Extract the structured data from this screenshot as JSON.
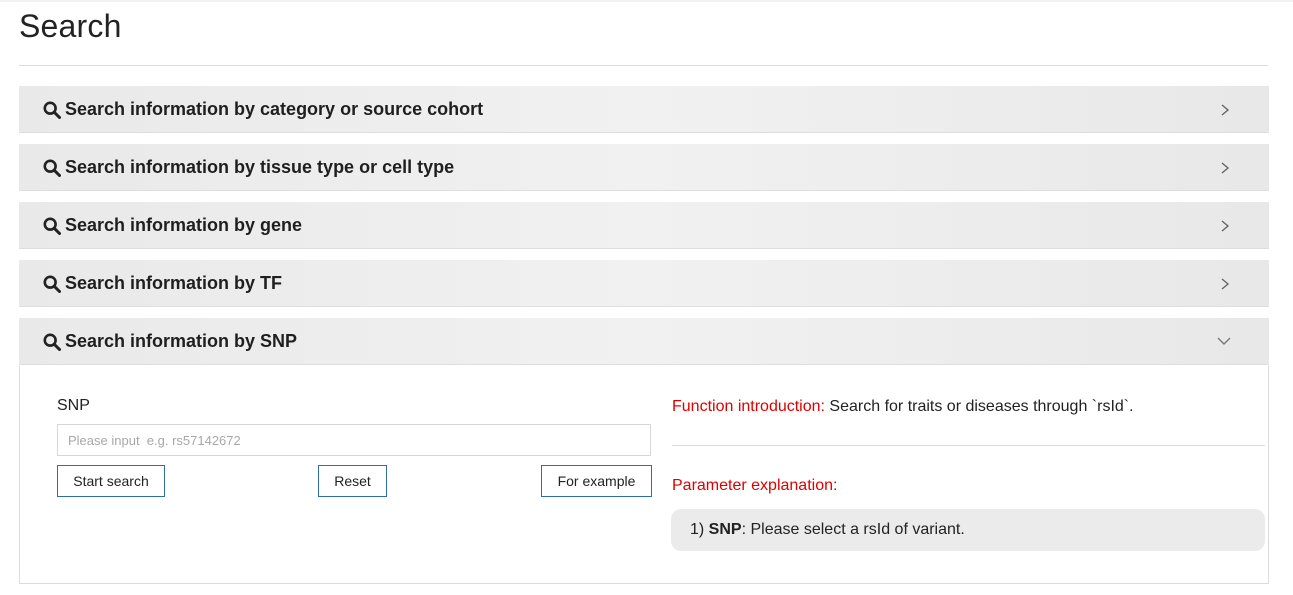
{
  "page": {
    "title": "Search"
  },
  "panels": [
    {
      "label": "Search information by category or source cohort",
      "icon": "search-icon",
      "state": "collapsed"
    },
    {
      "label": "Search information by tissue type or cell type",
      "icon": "search-icon",
      "state": "collapsed"
    },
    {
      "label": "Search information by gene",
      "icon": "search-icon",
      "state": "collapsed"
    },
    {
      "label": "Search information by TF",
      "icon": "search-icon",
      "state": "collapsed"
    },
    {
      "label": "Search information by SNP",
      "icon": "search-icon",
      "state": "expanded"
    }
  ],
  "snp_form": {
    "field_label": "SNP",
    "input_value": "",
    "input_placeholder": "Please input  e.g. rs57142672",
    "buttons": {
      "start": "Start search",
      "reset": "Reset",
      "example": "For example"
    }
  },
  "help": {
    "intro_label": "Function introduction:",
    "intro_text": " Search for traits or diseases through `rsId`.",
    "param_title": "Parameter explanation:",
    "param_index": "1) ",
    "param_name": "SNP",
    "param_desc": ": Please select a rsId of variant."
  },
  "colors": {
    "accent_red": "#e00000",
    "button_border": "#2d6fa3",
    "panel_bg": "#ebebeb"
  }
}
